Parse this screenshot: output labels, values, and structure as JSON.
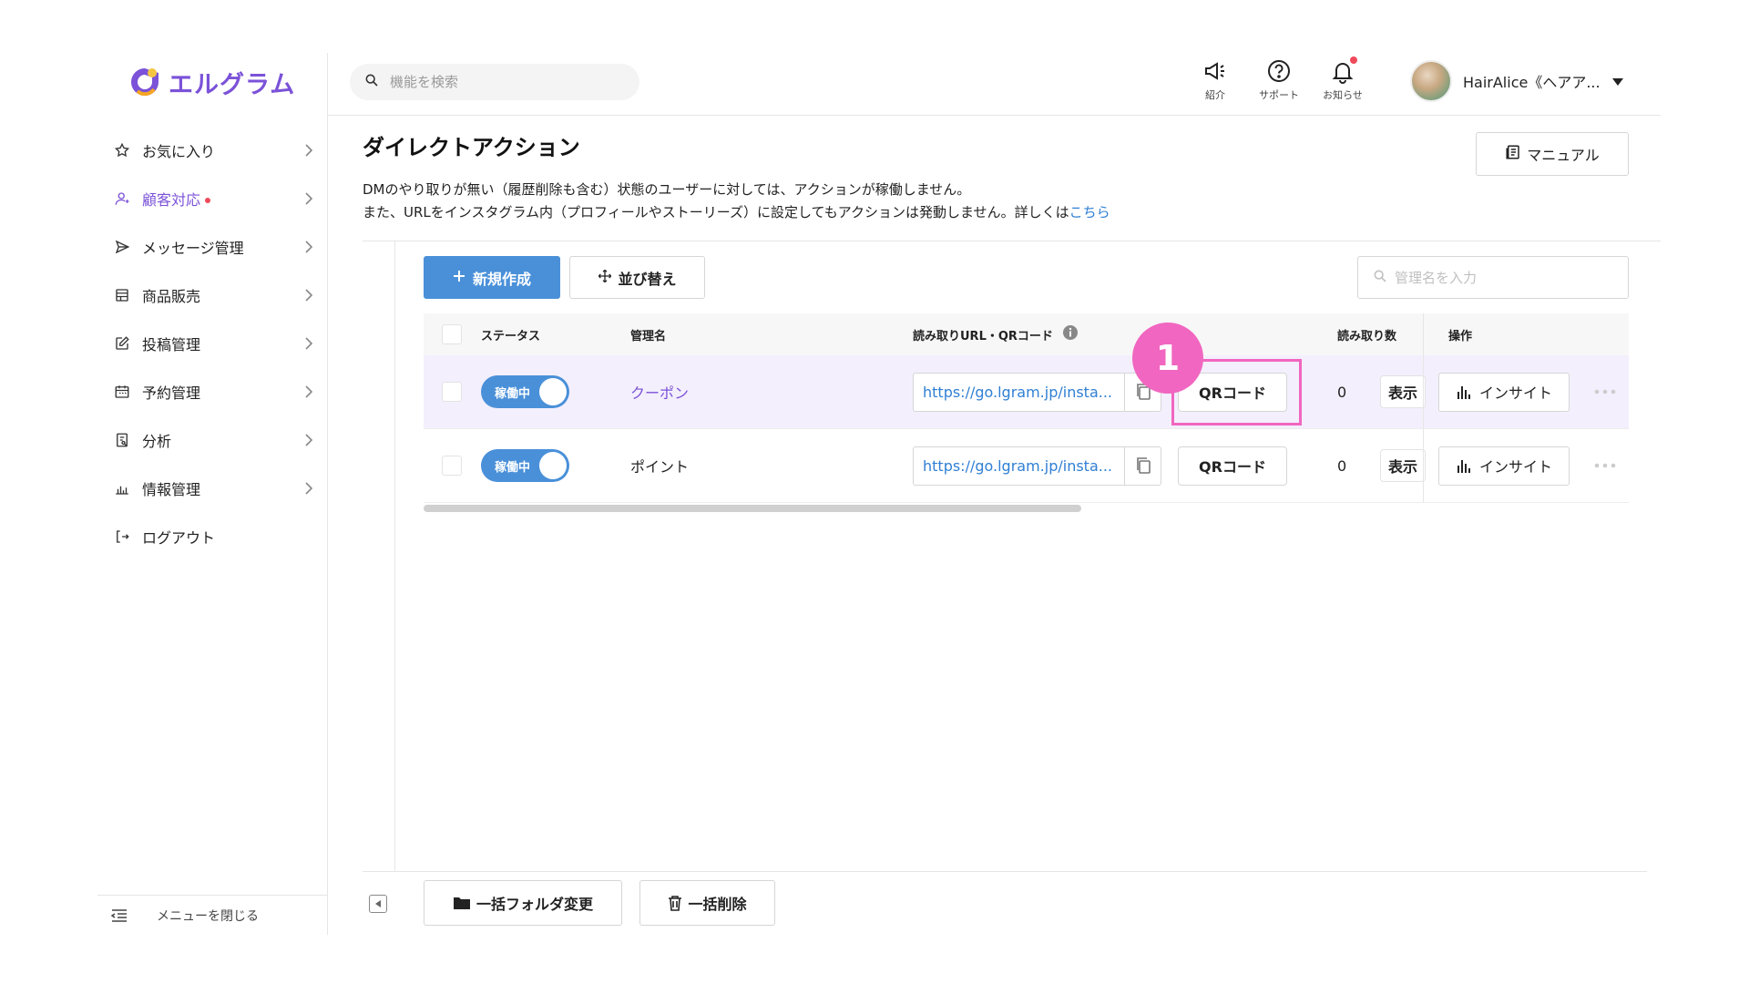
{
  "app": {
    "logo_text": "エルグラム",
    "brand_color": "#7b52d8",
    "accent_color": "#4a90d9",
    "annotation_color": "#f166c0"
  },
  "sidebar": {
    "items": [
      {
        "label": "お気に入り",
        "icon": "star-icon",
        "active": false
      },
      {
        "label": "顧客対応",
        "icon": "person-icon",
        "active": true,
        "badge_dot": true
      },
      {
        "label": "メッセージ管理",
        "icon": "send-icon",
        "active": false
      },
      {
        "label": "商品販売",
        "icon": "store-icon",
        "active": false
      },
      {
        "label": "投稿管理",
        "icon": "edit-icon",
        "active": false
      },
      {
        "label": "予約管理",
        "icon": "calendar-icon",
        "active": false
      },
      {
        "label": "分析",
        "icon": "report-icon",
        "active": false
      },
      {
        "label": "情報管理",
        "icon": "bar-chart-icon",
        "active": false
      }
    ],
    "logout_label": "ログアウト",
    "close_menu_label": "メニューを閉じる"
  },
  "header": {
    "search_placeholder": "機能を検索",
    "icons": [
      {
        "label": "紹介",
        "icon": "megaphone-icon"
      },
      {
        "label": "サポート",
        "icon": "help-icon"
      },
      {
        "label": "お知らせ",
        "icon": "bell-icon",
        "notification_dot": true
      }
    ],
    "account_name": "HairAlice《ヘアア..."
  },
  "main": {
    "title": "ダイレクトアクション",
    "manual_label": "マニュアル",
    "description_line1": "DMのやり取りが無い（履歴削除も含む）状態のユーザーに対しては、アクションが稼働しません。",
    "description_line2": "また、URLをインスタグラム内（プロフィールやストーリーズ）に設定してもアクションは発動しません。詳しくは",
    "description_link": "こちら",
    "new_button": "新規作成",
    "sort_button": "並び替え",
    "filter_placeholder": "管理名を入力"
  },
  "table": {
    "headers": {
      "status": "ステータス",
      "name": "管理名",
      "url": "読み取りURL・QRコード",
      "reads": "読み取り数",
      "ops": "操作"
    },
    "rows": [
      {
        "status": "稼働中",
        "name": "クーポン",
        "url": "https://go.lgram.jp/insta...",
        "qr_label": "QRコード",
        "reads": "0",
        "show_label": "表示",
        "insight_label": "インサイト"
      },
      {
        "status": "稼働中",
        "name": "ポイント",
        "url": "https://go.lgram.jp/insta...",
        "qr_label": "QRコード",
        "reads": "0",
        "show_label": "表示",
        "insight_label": "インサイト"
      }
    ]
  },
  "annotation": {
    "number": "1"
  },
  "footer": {
    "bulk_folder_label": "一括フォルダ変更",
    "bulk_delete_label": "一括削除"
  }
}
